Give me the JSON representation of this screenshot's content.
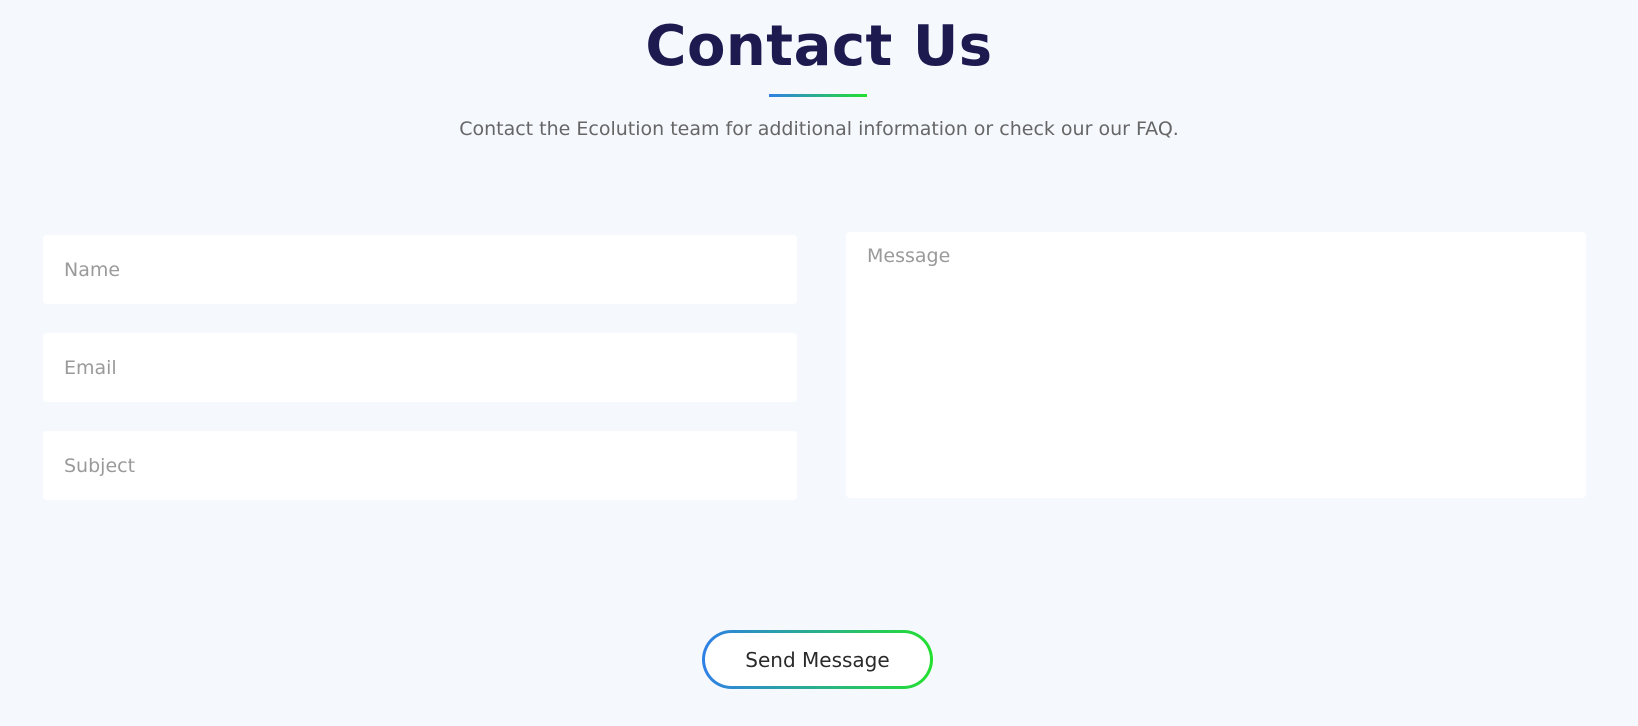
{
  "header": {
    "title": "Contact Us",
    "subtitle": "Contact the Ecolution team for additional information or check our our FAQ."
  },
  "form": {
    "name_placeholder": "Name",
    "email_placeholder": "Email",
    "subject_placeholder": "Subject",
    "message_placeholder": "Message",
    "send_label": "Send Message"
  },
  "colors": {
    "title": "#1c1a4f",
    "accent_start": "#2f7fe6",
    "accent_end": "#23e02f",
    "background": "#f5f8fd"
  }
}
